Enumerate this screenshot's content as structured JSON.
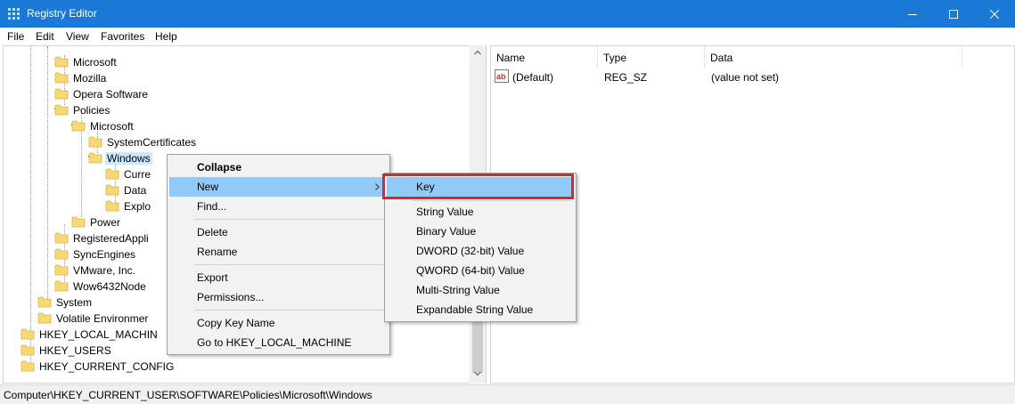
{
  "window": {
    "title": "Registry Editor"
  },
  "menu": [
    "File",
    "Edit",
    "View",
    "Favorites",
    "Help"
  ],
  "tree": [
    {
      "label": "Microsoft",
      "chev": "right"
    },
    {
      "label": "Mozilla",
      "chev": "right"
    },
    {
      "label": "Opera Software",
      "chev": "none"
    },
    {
      "label": "Policies",
      "chev": "down"
    },
    {
      "label": "Microsoft",
      "chev": "down"
    },
    {
      "label": "SystemCertificates",
      "chev": "right"
    },
    {
      "label": "Windows",
      "chev": "down",
      "selected": true
    },
    {
      "label": "Curre",
      "chev": "right"
    },
    {
      "label": "Data",
      "chev": "none"
    },
    {
      "label": "Explo",
      "chev": "none"
    },
    {
      "label": "Power",
      "chev": "right"
    },
    {
      "label": "RegisteredAppli",
      "chev": "none"
    },
    {
      "label": "SyncEngines",
      "chev": "right"
    },
    {
      "label": "VMware, Inc.",
      "chev": "right"
    },
    {
      "label": "Wow6432Node",
      "chev": "right"
    },
    {
      "label": "System",
      "chev": "right"
    },
    {
      "label": "Volatile Environmer",
      "chev": "right"
    },
    {
      "label": "HKEY_LOCAL_MACHIN",
      "chev": "right"
    },
    {
      "label": "HKEY_USERS",
      "chev": "right"
    },
    {
      "label": "HKEY_CURRENT_CONFIG",
      "chev": "right"
    }
  ],
  "list": {
    "columns": [
      "Name",
      "Type",
      "Data"
    ],
    "rows": [
      {
        "name": "(Default)",
        "type": "REG_SZ",
        "data": "(value not set)",
        "icon": "string-value-icon",
        "icon_text": "ab"
      }
    ]
  },
  "context_menu": {
    "items": [
      "Collapse",
      "New",
      "Find...",
      "Delete",
      "Rename",
      "Export",
      "Permissions...",
      "Copy Key Name",
      "Go to HKEY_LOCAL_MACHINE"
    ],
    "highlighted": "New"
  },
  "submenu": {
    "items": [
      "Key",
      "String Value",
      "Binary Value",
      "DWORD (32-bit) Value",
      "QWORD (64-bit) Value",
      "Multi-String Value",
      "Expandable String Value"
    ],
    "highlighted": "Key"
  },
  "status": "Computer\\HKEY_CURRENT_USER\\SOFTWARE\\Policies\\Microsoft\\Windows",
  "colors": {
    "titlebar": "#1a79d6",
    "selection": "#cce8ff",
    "menu_highlight": "#91c9f7",
    "highlight_box": "#d9272e",
    "folder": "#f8d775"
  }
}
